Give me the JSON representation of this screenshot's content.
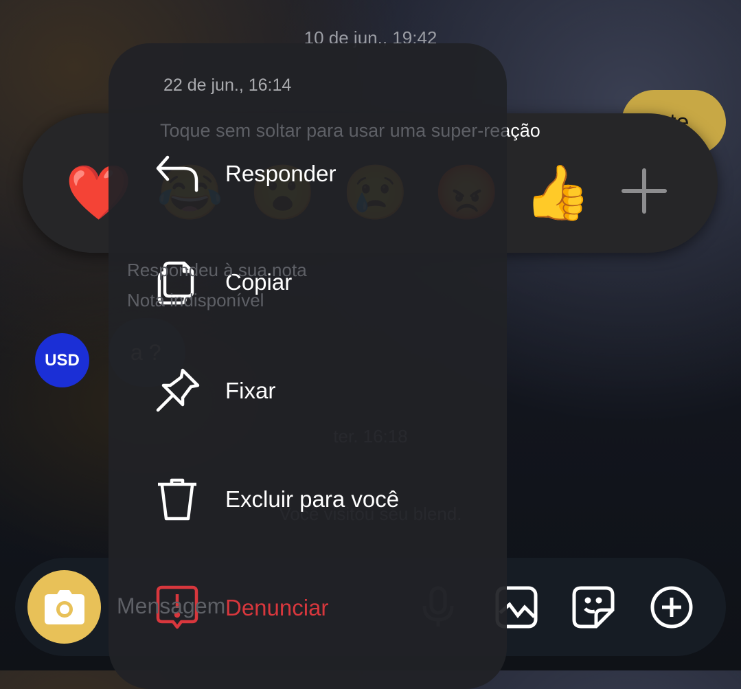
{
  "chat": {
    "date_top": "10 de jun., 19:42",
    "bubble_right": "te",
    "note_reply": "Respondeu à sua nota",
    "note_unavailable": "Nota indisponível",
    "avatar_text": "USD",
    "message_text": "a ?",
    "date_mid": "ter. 16:18",
    "blend_text": "Você visitou seu blend."
  },
  "reactions": {
    "hint": "Toque sem soltar para usar uma super-reação",
    "emojis": [
      "❤️",
      "😂",
      "😮",
      "😢",
      "😡",
      "👍"
    ],
    "more_icon": "plus-icon"
  },
  "composer": {
    "placeholder": "Mensagem",
    "camera_color": "#e8c158",
    "icons": [
      "camera-icon",
      "microphone-icon",
      "gallery-icon",
      "sticker-icon",
      "plus-circle-icon"
    ]
  },
  "menu": {
    "timestamp": "22 de jun., 16:14",
    "items": [
      {
        "label": "Responder",
        "icon": "reply-icon"
      },
      {
        "label": "Copiar",
        "icon": "copy-icon"
      },
      {
        "label": "Fixar",
        "icon": "pin-icon"
      },
      {
        "label": "Excluir para você",
        "icon": "trash-icon"
      },
      {
        "label": "Denunciar",
        "icon": "report-icon",
        "color": "#d8373d"
      }
    ]
  }
}
